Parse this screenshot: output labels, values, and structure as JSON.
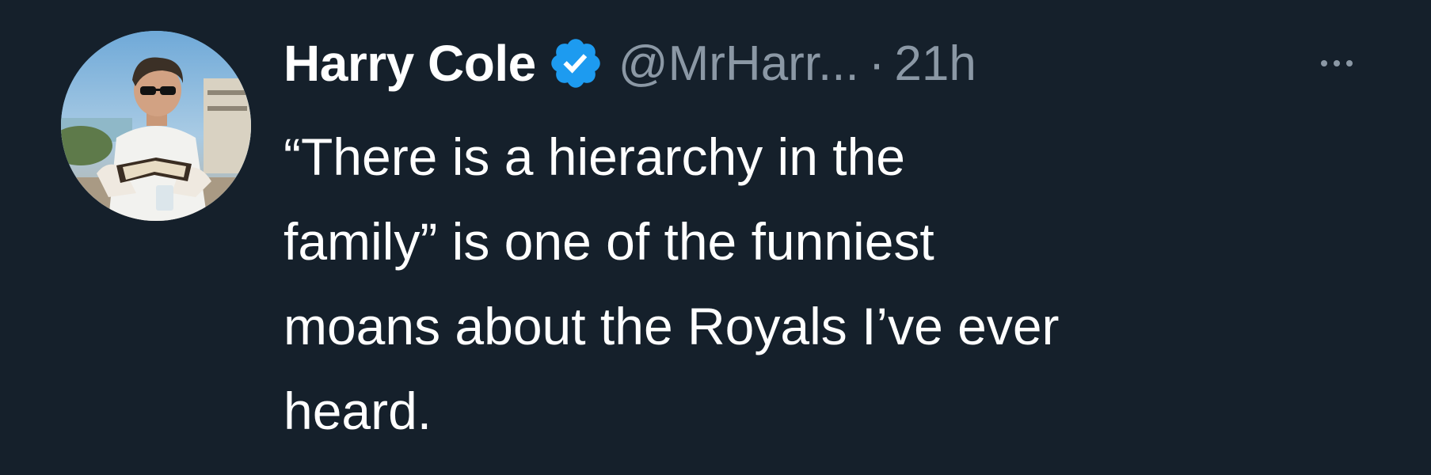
{
  "tweet": {
    "display_name": "Harry Cole",
    "handle": "@MrHarr...",
    "separator": "·",
    "time": "21h",
    "verified_color": "#1d9bf0",
    "text_lines": [
      "“There is a hierarchy in the",
      "family” is one of the funniest",
      "moans about the Royals I’ve ever",
      "heard."
    ],
    "icons": {
      "verified": "verified-badge-icon",
      "more": "more-options-icon"
    }
  },
  "colors": {
    "background": "#15202b",
    "primary_text": "#ffffff",
    "secondary_text": "#8b98a5"
  }
}
